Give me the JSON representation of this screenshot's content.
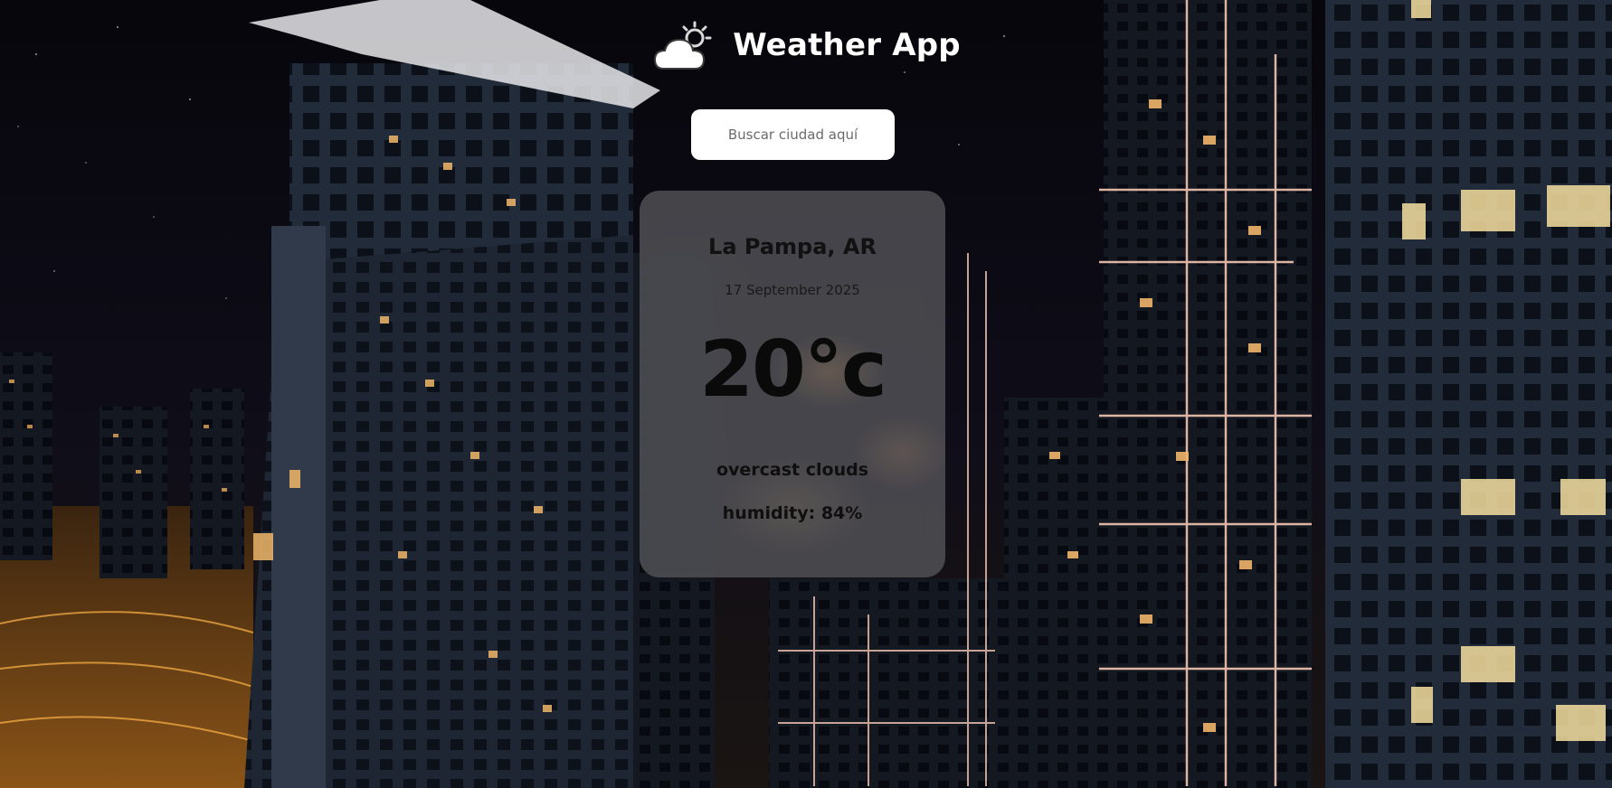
{
  "header": {
    "title": "Weather App",
    "logo_icon": "cloud-sun-icon"
  },
  "search": {
    "placeholder": "Buscar ciudad aquí",
    "value": ""
  },
  "weather": {
    "city": "La Pampa, AR",
    "date": "17 September 2025",
    "temperature": "20°c",
    "description": "overcast clouds",
    "humidity": "humidity: 84%"
  },
  "background": {
    "scene": "night-city-skyscrapers",
    "colors": {
      "sky": "#0b0a12",
      "building": "#2a3140",
      "light": "#f3b86a",
      "neon": "#f4c6b4"
    }
  }
}
